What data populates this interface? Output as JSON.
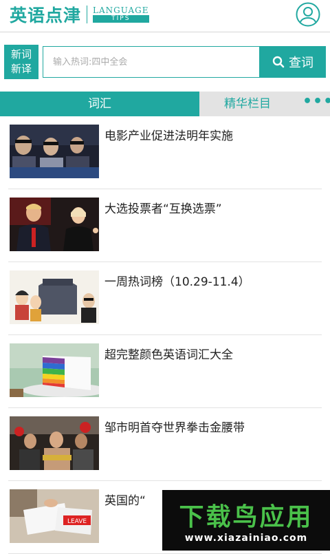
{
  "header": {
    "logo_cn": "英语点津",
    "logo_en_line1": "LANGUAGE",
    "logo_en_line2": "TIPS",
    "user_icon": "user-avatar-icon"
  },
  "search": {
    "tag_line1": "新词",
    "tag_line2": "新译",
    "placeholder": "输入热词:四中全会",
    "button_label": "查词",
    "button_icon": "search-icon"
  },
  "tabs": [
    {
      "label": "词汇",
      "active": true
    },
    {
      "label": "精华栏目",
      "active": false
    },
    {
      "label": "•••",
      "active": false
    }
  ],
  "articles": [
    {
      "title": "电影产业促进法明年实施",
      "thumb": "cinema-audience-photo"
    },
    {
      "title": "大选投票者“互换选票”",
      "thumb": "candidates-debate-photo"
    },
    {
      "title": "一周热词榜（10.29-11.4）",
      "thumb": "cartoon-illustration"
    },
    {
      "title": "超完整颜色英语词汇大全",
      "thumb": "rainbow-cake-photo"
    },
    {
      "title": "邹市明首夺世界拳击金腰带",
      "thumb": "boxing-champion-photo"
    },
    {
      "title": "英国的“",
      "thumb": "leave-ballot-photo"
    }
  ],
  "watermark": {
    "cn": "下载鸟应用",
    "url": "www.xiazainiao.com",
    "thumb_text": "LEAVE"
  },
  "colors": {
    "accent": "#20a8a0",
    "tab_bg": "#e3e3e3",
    "watermark_green": "#4ac14a"
  }
}
